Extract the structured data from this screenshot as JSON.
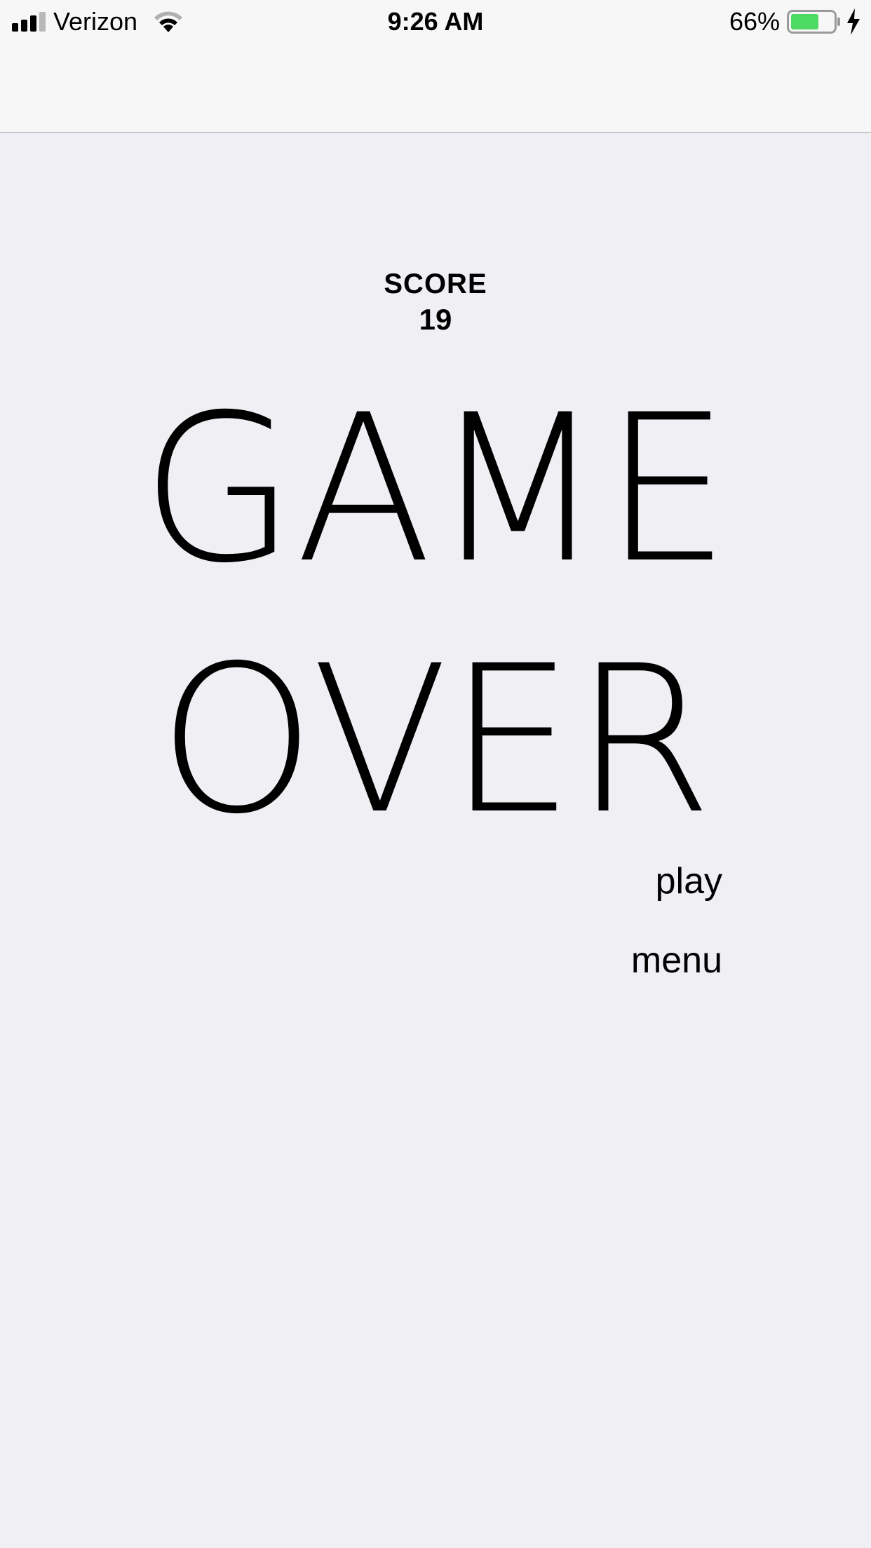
{
  "status_bar": {
    "carrier": "Verizon",
    "time": "9:26 AM",
    "battery_percent": "66%",
    "battery_level": 0.66,
    "battery_color": "#4cd964"
  },
  "score": {
    "label": "SCORE",
    "value": "19"
  },
  "title": {
    "line1": "GAME",
    "line2": "OVER"
  },
  "actions": {
    "play": "play",
    "menu": "menu"
  }
}
